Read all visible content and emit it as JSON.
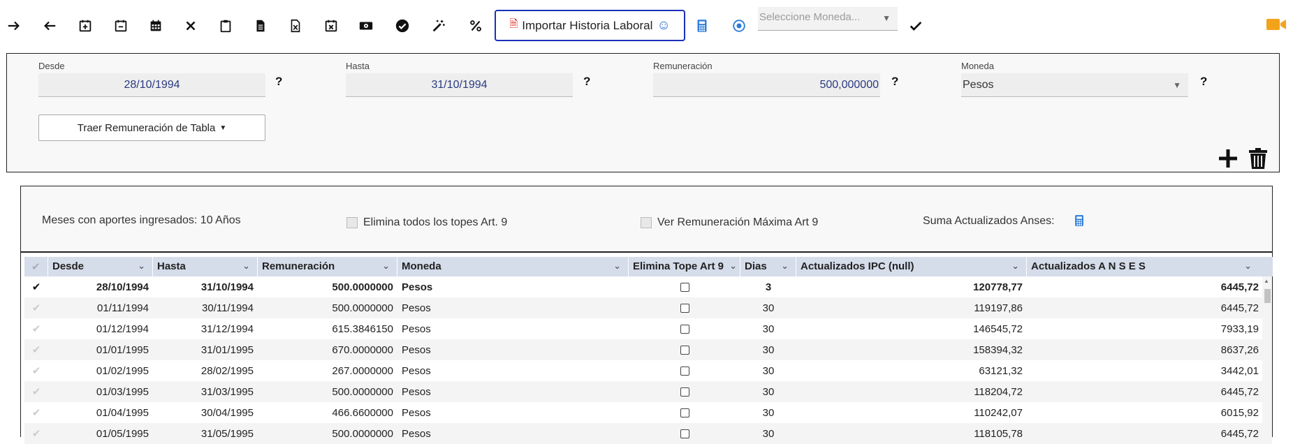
{
  "toolbar": {
    "icons": [
      "arrow-right-icon",
      "arrow-left-icon",
      "calendar-plus-icon",
      "calendar-minus-icon",
      "calendar-grid-icon",
      "close-icon",
      "clipboard-icon",
      "document-icon",
      "excel-file-icon",
      "calendar-x-icon",
      "money-icon",
      "check-circle-icon",
      "magic-wand-icon",
      "percent-icon"
    ],
    "import_label": "Importar Historia Laboral",
    "currency_placeholder": "Seleccione Moneda..."
  },
  "form": {
    "desde_label": "Desde",
    "desde_value": "28/10/1994",
    "hasta_label": "Hasta",
    "hasta_value": "31/10/1994",
    "remuneracion_label": "Remuneración",
    "remuneracion_value": "500,000000",
    "moneda_label": "Moneda",
    "moneda_value": "Pesos",
    "help_mark": "?",
    "traer_label": "Traer Remuneración de Tabla"
  },
  "summary": {
    "meses_text": "Meses con aportes ingresados: 10 Años",
    "elimina_topes_label": "Elimina todos los topes Art. 9",
    "ver_remuneracion_label": "Ver Remuneración Máxima Art 9",
    "suma_label": "Suma Actualizados Anses:"
  },
  "grid": {
    "columns": [
      "Desde",
      "Hasta",
      "Remuneración",
      "Moneda",
      "Elimina Tope Art 9",
      "Dias",
      "Actualizados IPC (null)",
      "Actualizados A N S E S"
    ],
    "rows": [
      {
        "desde": "28/10/1994",
        "hasta": "31/10/1994",
        "remuneracion": "500.0000000",
        "moneda": "Pesos",
        "dias": "3",
        "ipc": "120778,77",
        "anses": "6445,72"
      },
      {
        "desde": "01/11/1994",
        "hasta": "30/11/1994",
        "remuneracion": "500.0000000",
        "moneda": "Pesos",
        "dias": "30",
        "ipc": "119197,86",
        "anses": "6445,72"
      },
      {
        "desde": "01/12/1994",
        "hasta": "31/12/1994",
        "remuneracion": "615.3846150",
        "moneda": "Pesos",
        "dias": "30",
        "ipc": "146545,72",
        "anses": "7933,19"
      },
      {
        "desde": "01/01/1995",
        "hasta": "31/01/1995",
        "remuneracion": "670.0000000",
        "moneda": "Pesos",
        "dias": "30",
        "ipc": "158394,32",
        "anses": "8637,26"
      },
      {
        "desde": "01/02/1995",
        "hasta": "28/02/1995",
        "remuneracion": "267.0000000",
        "moneda": "Pesos",
        "dias": "30",
        "ipc": "63121,32",
        "anses": "3442,01"
      },
      {
        "desde": "01/03/1995",
        "hasta": "31/03/1995",
        "remuneracion": "500.0000000",
        "moneda": "Pesos",
        "dias": "30",
        "ipc": "118204,72",
        "anses": "6445,72"
      },
      {
        "desde": "01/04/1995",
        "hasta": "30/04/1995",
        "remuneracion": "466.6600000",
        "moneda": "Pesos",
        "dias": "30",
        "ipc": "110242,07",
        "anses": "6015,92"
      },
      {
        "desde": "01/05/1995",
        "hasta": "31/05/1995",
        "remuneracion": "500.0000000",
        "moneda": "Pesos",
        "dias": "30",
        "ipc": "118105,78",
        "anses": "6445,72"
      }
    ]
  }
}
